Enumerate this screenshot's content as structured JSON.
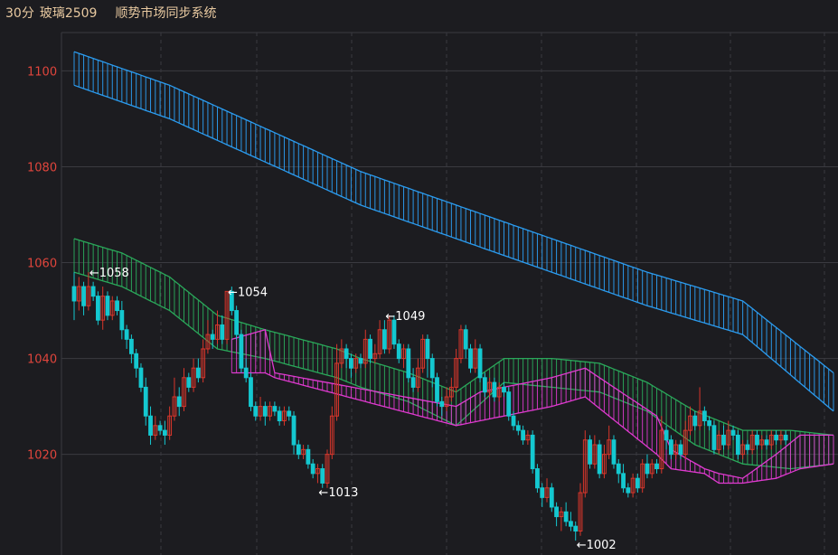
{
  "header": {
    "period": "30分",
    "symbol": "玻璃2509",
    "system": "顺势市场同步系统"
  },
  "colors": {
    "background": "#1c1c20",
    "grid": "#3a3a40",
    "tick_label": "#e0453c",
    "header_text": "#e8c9a0",
    "up_candle": "#d9362b",
    "down_candle": "#14c8d0",
    "upper_band": "#2b9cf0",
    "middle_band": "#2aa85a",
    "lower_band_line": "#e03ad0"
  },
  "chart_data": {
    "type": "candlestick",
    "ylim": [
      999,
      1108
    ],
    "yticks": [
      1020,
      1040,
      1060,
      1080,
      1100
    ],
    "xlabel": "",
    "ylabel": "",
    "grid": true,
    "bar_count": 160,
    "upper_band": {
      "top": [
        [
          0,
          1104
        ],
        [
          20,
          1097
        ],
        [
          40,
          1088
        ],
        [
          60,
          1079
        ],
        [
          80,
          1072
        ],
        [
          100,
          1065
        ],
        [
          120,
          1058
        ],
        [
          140,
          1052
        ],
        [
          159,
          1037
        ]
      ],
      "bottom": [
        [
          0,
          1097
        ],
        [
          20,
          1090
        ],
        [
          40,
          1081
        ],
        [
          60,
          1072
        ],
        [
          80,
          1065
        ],
        [
          100,
          1058
        ],
        [
          120,
          1051
        ],
        [
          140,
          1045
        ],
        [
          159,
          1029
        ]
      ]
    },
    "middle_band": {
      "top": [
        [
          0,
          1065
        ],
        [
          10,
          1062
        ],
        [
          20,
          1057
        ],
        [
          30,
          1049
        ],
        [
          40,
          1046
        ],
        [
          55,
          1042
        ],
        [
          60,
          1040
        ],
        [
          70,
          1037
        ],
        [
          80,
          1033
        ],
        [
          90,
          1040
        ],
        [
          100,
          1040
        ],
        [
          110,
          1039
        ],
        [
          120,
          1035
        ],
        [
          130,
          1029
        ],
        [
          140,
          1025
        ],
        [
          150,
          1025
        ],
        [
          159,
          1024
        ]
      ],
      "bottom": [
        [
          0,
          1058
        ],
        [
          10,
          1055
        ],
        [
          20,
          1050
        ],
        [
          30,
          1042
        ],
        [
          40,
          1040
        ],
        [
          55,
          1036
        ],
        [
          60,
          1034
        ],
        [
          70,
          1031
        ],
        [
          80,
          1026
        ],
        [
          90,
          1035
        ],
        [
          100,
          1034
        ],
        [
          110,
          1033
        ],
        [
          120,
          1029
        ],
        [
          130,
          1022
        ],
        [
          140,
          1018
        ],
        [
          150,
          1017
        ],
        [
          159,
          1018
        ]
      ]
    },
    "lower_band_line": {
      "top": [
        [
          33,
          1044
        ],
        [
          40,
          1046
        ],
        [
          42,
          1037
        ],
        [
          80,
          1030
        ],
        [
          85,
          1033
        ],
        [
          100,
          1036
        ],
        [
          107,
          1038
        ],
        [
          122,
          1028
        ],
        [
          125,
          1021
        ],
        [
          132,
          1017
        ],
        [
          135,
          1016
        ],
        [
          140,
          1015
        ],
        [
          147,
          1020
        ],
        [
          152,
          1024
        ],
        [
          159,
          1024
        ]
      ],
      "bottom": [
        [
          33,
          1037
        ],
        [
          40,
          1037
        ],
        [
          42,
          1036
        ],
        [
          80,
          1026
        ],
        [
          85,
          1027
        ],
        [
          100,
          1030
        ],
        [
          107,
          1032
        ],
        [
          122,
          1020
        ],
        [
          125,
          1017
        ],
        [
          132,
          1016
        ],
        [
          135,
          1014
        ],
        [
          140,
          1014
        ],
        [
          147,
          1015
        ],
        [
          152,
          1017
        ],
        [
          159,
          1018
        ]
      ]
    },
    "candles": [
      {
        "o": 1055,
        "c": 1052,
        "h": 1058,
        "l": 1048
      },
      {
        "o": 1052,
        "c": 1055,
        "h": 1057,
        "l": 1050
      },
      {
        "o": 1055,
        "c": 1051,
        "h": 1056,
        "l": 1049
      },
      {
        "o": 1051,
        "c": 1055,
        "h": 1058,
        "l": 1050
      },
      {
        "o": 1055,
        "c": 1053,
        "h": 1056,
        "l": 1052
      },
      {
        "o": 1053,
        "c": 1048,
        "h": 1054,
        "l": 1047
      },
      {
        "o": 1048,
        "c": 1053,
        "h": 1055,
        "l": 1046
      },
      {
        "o": 1053,
        "c": 1049,
        "h": 1054,
        "l": 1048
      },
      {
        "o": 1049,
        "c": 1052,
        "h": 1053,
        "l": 1048
      },
      {
        "o": 1052,
        "c": 1050,
        "h": 1053,
        "l": 1049
      },
      {
        "o": 1050,
        "c": 1046,
        "h": 1052,
        "l": 1044
      },
      {
        "o": 1046,
        "c": 1044,
        "h": 1047,
        "l": 1042
      },
      {
        "o": 1044,
        "c": 1041,
        "h": 1045,
        "l": 1039
      },
      {
        "o": 1041,
        "c": 1038,
        "h": 1042,
        "l": 1036
      },
      {
        "o": 1038,
        "c": 1034,
        "h": 1039,
        "l": 1033
      },
      {
        "o": 1034,
        "c": 1028,
        "h": 1036,
        "l": 1026
      },
      {
        "o": 1028,
        "c": 1024,
        "h": 1030,
        "l": 1022
      },
      {
        "o": 1024,
        "c": 1026,
        "h": 1028,
        "l": 1023
      },
      {
        "o": 1026,
        "c": 1025,
        "h": 1027,
        "l": 1024
      },
      {
        "o": 1025,
        "c": 1024,
        "h": 1027,
        "l": 1022
      },
      {
        "o": 1024,
        "c": 1028,
        "h": 1030,
        "l": 1023
      },
      {
        "o": 1028,
        "c": 1032,
        "h": 1036,
        "l": 1027
      },
      {
        "o": 1032,
        "c": 1030,
        "h": 1034,
        "l": 1028
      },
      {
        "o": 1030,
        "c": 1036,
        "h": 1038,
        "l": 1029
      },
      {
        "o": 1036,
        "c": 1034,
        "h": 1037,
        "l": 1033
      },
      {
        "o": 1034,
        "c": 1038,
        "h": 1040,
        "l": 1033
      },
      {
        "o": 1038,
        "c": 1036,
        "h": 1040,
        "l": 1035
      },
      {
        "o": 1036,
        "c": 1042,
        "h": 1044,
        "l": 1035
      },
      {
        "o": 1042,
        "c": 1045,
        "h": 1048,
        "l": 1041
      },
      {
        "o": 1045,
        "c": 1044,
        "h": 1046,
        "l": 1042
      },
      {
        "o": 1044,
        "c": 1047,
        "h": 1050,
        "l": 1043
      },
      {
        "o": 1047,
        "c": 1044,
        "h": 1049,
        "l": 1043
      },
      {
        "o": 1044,
        "c": 1054,
        "h": 1054,
        "l": 1043
      },
      {
        "o": 1054,
        "c": 1050,
        "h": 1055,
        "l": 1049
      },
      {
        "o": 1050,
        "c": 1045,
        "h": 1051,
        "l": 1044
      },
      {
        "o": 1045,
        "c": 1038,
        "h": 1046,
        "l": 1037
      },
      {
        "o": 1038,
        "c": 1036,
        "h": 1040,
        "l": 1035
      },
      {
        "o": 1036,
        "c": 1030,
        "h": 1037,
        "l": 1029
      },
      {
        "o": 1030,
        "c": 1028,
        "h": 1031,
        "l": 1027
      },
      {
        "o": 1028,
        "c": 1030,
        "h": 1032,
        "l": 1027
      },
      {
        "o": 1030,
        "c": 1028,
        "h": 1031,
        "l": 1026
      },
      {
        "o": 1028,
        "c": 1030,
        "h": 1031,
        "l": 1027
      },
      {
        "o": 1030,
        "c": 1029,
        "h": 1031,
        "l": 1028
      },
      {
        "o": 1029,
        "c": 1027,
        "h": 1030,
        "l": 1026
      },
      {
        "o": 1027,
        "c": 1029,
        "h": 1030,
        "l": 1026
      },
      {
        "o": 1029,
        "c": 1028,
        "h": 1030,
        "l": 1027
      },
      {
        "o": 1028,
        "c": 1022,
        "h": 1029,
        "l": 1020
      },
      {
        "o": 1022,
        "c": 1020,
        "h": 1023,
        "l": 1019
      },
      {
        "o": 1020,
        "c": 1021,
        "h": 1022,
        "l": 1019
      },
      {
        "o": 1021,
        "c": 1018,
        "h": 1022,
        "l": 1017
      },
      {
        "o": 1018,
        "c": 1016,
        "h": 1019,
        "l": 1015
      },
      {
        "o": 1016,
        "c": 1017,
        "h": 1018,
        "l": 1014
      },
      {
        "o": 1017,
        "c": 1014,
        "h": 1018,
        "l": 1013
      },
      {
        "o": 1014,
        "c": 1020,
        "h": 1021,
        "l": 1013
      },
      {
        "o": 1020,
        "c": 1028,
        "h": 1030,
        "l": 1019
      },
      {
        "o": 1028,
        "c": 1039,
        "h": 1043,
        "l": 1027
      },
      {
        "o": 1039,
        "c": 1042,
        "h": 1044,
        "l": 1038
      },
      {
        "o": 1042,
        "c": 1040,
        "h": 1043,
        "l": 1038
      },
      {
        "o": 1040,
        "c": 1038,
        "h": 1041,
        "l": 1036
      },
      {
        "o": 1038,
        "c": 1040,
        "h": 1041,
        "l": 1037
      },
      {
        "o": 1040,
        "c": 1039,
        "h": 1041,
        "l": 1038
      },
      {
        "o": 1039,
        "c": 1044,
        "h": 1046,
        "l": 1038
      },
      {
        "o": 1044,
        "c": 1040,
        "h": 1045,
        "l": 1039
      },
      {
        "o": 1040,
        "c": 1041,
        "h": 1043,
        "l": 1039
      },
      {
        "o": 1041,
        "c": 1046,
        "h": 1048,
        "l": 1040
      },
      {
        "o": 1046,
        "c": 1042,
        "h": 1048,
        "l": 1041
      },
      {
        "o": 1042,
        "c": 1048,
        "h": 1049,
        "l": 1041
      },
      {
        "o": 1048,
        "c": 1043,
        "h": 1049,
        "l": 1042
      },
      {
        "o": 1043,
        "c": 1040,
        "h": 1044,
        "l": 1039
      },
      {
        "o": 1040,
        "c": 1042,
        "h": 1043,
        "l": 1038
      },
      {
        "o": 1042,
        "c": 1036,
        "h": 1043,
        "l": 1035
      },
      {
        "o": 1036,
        "c": 1034,
        "h": 1038,
        "l": 1033
      },
      {
        "o": 1034,
        "c": 1038,
        "h": 1040,
        "l": 1033
      },
      {
        "o": 1038,
        "c": 1044,
        "h": 1045,
        "l": 1037
      },
      {
        "o": 1044,
        "c": 1040,
        "h": 1045,
        "l": 1036
      },
      {
        "o": 1040,
        "c": 1036,
        "h": 1041,
        "l": 1034
      },
      {
        "o": 1036,
        "c": 1031,
        "h": 1037,
        "l": 1030
      },
      {
        "o": 1031,
        "c": 1030,
        "h": 1032,
        "l": 1028
      },
      {
        "o": 1030,
        "c": 1032,
        "h": 1034,
        "l": 1029
      },
      {
        "o": 1032,
        "c": 1034,
        "h": 1036,
        "l": 1031
      },
      {
        "o": 1034,
        "c": 1040,
        "h": 1042,
        "l": 1033
      },
      {
        "o": 1040,
        "c": 1046,
        "h": 1047,
        "l": 1039
      },
      {
        "o": 1046,
        "c": 1042,
        "h": 1047,
        "l": 1040
      },
      {
        "o": 1042,
        "c": 1038,
        "h": 1043,
        "l": 1037
      },
      {
        "o": 1038,
        "c": 1042,
        "h": 1044,
        "l": 1037
      },
      {
        "o": 1042,
        "c": 1036,
        "h": 1043,
        "l": 1035
      },
      {
        "o": 1036,
        "c": 1033,
        "h": 1037,
        "l": 1032
      },
      {
        "o": 1033,
        "c": 1035,
        "h": 1036,
        "l": 1032
      },
      {
        "o": 1035,
        "c": 1032,
        "h": 1036,
        "l": 1031
      },
      {
        "o": 1032,
        "c": 1034,
        "h": 1035,
        "l": 1031
      },
      {
        "o": 1034,
        "c": 1033,
        "h": 1035,
        "l": 1032
      },
      {
        "o": 1033,
        "c": 1028,
        "h": 1034,
        "l": 1027
      },
      {
        "o": 1028,
        "c": 1026,
        "h": 1029,
        "l": 1025
      },
      {
        "o": 1026,
        "c": 1025,
        "h": 1027,
        "l": 1024
      },
      {
        "o": 1025,
        "c": 1023,
        "h": 1026,
        "l": 1022
      },
      {
        "o": 1023,
        "c": 1024,
        "h": 1025,
        "l": 1022
      },
      {
        "o": 1024,
        "c": 1017,
        "h": 1025,
        "l": 1016
      },
      {
        "o": 1017,
        "c": 1013,
        "h": 1018,
        "l": 1012
      },
      {
        "o": 1013,
        "c": 1011,
        "h": 1014,
        "l": 1009
      },
      {
        "o": 1011,
        "c": 1013,
        "h": 1015,
        "l": 1010
      },
      {
        "o": 1013,
        "c": 1009,
        "h": 1014,
        "l": 1008
      },
      {
        "o": 1009,
        "c": 1007,
        "h": 1010,
        "l": 1005
      },
      {
        "o": 1007,
        "c": 1008,
        "h": 1009,
        "l": 1004
      },
      {
        "o": 1008,
        "c": 1006,
        "h": 1010,
        "l": 1005
      },
      {
        "o": 1006,
        "c": 1005,
        "h": 1008,
        "l": 1004
      },
      {
        "o": 1005,
        "c": 1004,
        "h": 1006,
        "l": 1002
      },
      {
        "o": 1004,
        "c": 1012,
        "h": 1014,
        "l": 1003
      },
      {
        "o": 1012,
        "c": 1023,
        "h": 1025,
        "l": 1011
      },
      {
        "o": 1023,
        "c": 1018,
        "h": 1024,
        "l": 1017
      },
      {
        "o": 1018,
        "c": 1022,
        "h": 1024,
        "l": 1017
      },
      {
        "o": 1022,
        "c": 1016,
        "h": 1023,
        "l": 1015
      },
      {
        "o": 1016,
        "c": 1020,
        "h": 1022,
        "l": 1015
      },
      {
        "o": 1020,
        "c": 1023,
        "h": 1026,
        "l": 1019
      },
      {
        "o": 1023,
        "c": 1018,
        "h": 1024,
        "l": 1017
      },
      {
        "o": 1018,
        "c": 1016,
        "h": 1019,
        "l": 1014
      },
      {
        "o": 1016,
        "c": 1013,
        "h": 1018,
        "l": 1012
      },
      {
        "o": 1013,
        "c": 1012,
        "h": 1014,
        "l": 1011
      },
      {
        "o": 1012,
        "c": 1015,
        "h": 1016,
        "l": 1011
      },
      {
        "o": 1015,
        "c": 1013,
        "h": 1016,
        "l": 1012
      },
      {
        "o": 1013,
        "c": 1018,
        "h": 1019,
        "l": 1012
      },
      {
        "o": 1018,
        "c": 1016,
        "h": 1020,
        "l": 1015
      },
      {
        "o": 1016,
        "c": 1018,
        "h": 1019,
        "l": 1015
      },
      {
        "o": 1018,
        "c": 1017,
        "h": 1019,
        "l": 1016
      },
      {
        "o": 1017,
        "c": 1025,
        "h": 1028,
        "l": 1016
      },
      {
        "o": 1025,
        "c": 1023,
        "h": 1026,
        "l": 1021
      },
      {
        "o": 1023,
        "c": 1020,
        "h": 1024,
        "l": 1019
      },
      {
        "o": 1020,
        "c": 1022,
        "h": 1023,
        "l": 1019
      },
      {
        "o": 1022,
        "c": 1020,
        "h": 1023,
        "l": 1019
      },
      {
        "o": 1020,
        "c": 1025,
        "h": 1027,
        "l": 1019
      },
      {
        "o": 1025,
        "c": 1028,
        "h": 1030,
        "l": 1024
      },
      {
        "o": 1028,
        "c": 1026,
        "h": 1029,
        "l": 1025
      },
      {
        "o": 1026,
        "c": 1029,
        "h": 1034,
        "l": 1025
      },
      {
        "o": 1029,
        "c": 1027,
        "h": 1030,
        "l": 1026
      },
      {
        "o": 1027,
        "c": 1026,
        "h": 1028,
        "l": 1025
      },
      {
        "o": 1026,
        "c": 1021,
        "h": 1027,
        "l": 1020
      },
      {
        "o": 1021,
        "c": 1024,
        "h": 1025,
        "l": 1020
      },
      {
        "o": 1024,
        "c": 1022,
        "h": 1026,
        "l": 1021
      },
      {
        "o": 1022,
        "c": 1025,
        "h": 1027,
        "l": 1021
      },
      {
        "o": 1025,
        "c": 1024,
        "h": 1026,
        "l": 1023
      },
      {
        "o": 1024,
        "c": 1020,
        "h": 1025,
        "l": 1019
      },
      {
        "o": 1020,
        "c": 1022,
        "h": 1023,
        "l": 1019
      },
      {
        "o": 1022,
        "c": 1021,
        "h": 1023,
        "l": 1020
      },
      {
        "o": 1021,
        "c": 1024,
        "h": 1025,
        "l": 1020
      },
      {
        "o": 1024,
        "c": 1022,
        "h": 1025,
        "l": 1021
      },
      {
        "o": 1022,
        "c": 1023,
        "h": 1024,
        "l": 1021
      },
      {
        "o": 1023,
        "c": 1022,
        "h": 1024,
        "l": 1021
      },
      {
        "o": 1022,
        "c": 1024,
        "h": 1025,
        "l": 1021
      },
      {
        "o": 1024,
        "c": 1023,
        "h": 1025,
        "l": 1022
      },
      {
        "o": 1023,
        "c": 1024,
        "h": 1025,
        "l": 1022
      },
      {
        "o": 1024,
        "c": 1023,
        "h": 1025,
        "l": 1022
      }
    ],
    "annotations": [
      {
        "bar": 3,
        "value": 1058,
        "label": "←1058"
      },
      {
        "bar": 32,
        "value": 1054,
        "label": "←1054"
      },
      {
        "bar": 65,
        "value": 1049,
        "label": "←1049"
      },
      {
        "bar": 51,
        "value": 1013,
        "label": "←1013"
      },
      {
        "bar": 105,
        "value": 1002,
        "label": "←1002"
      }
    ]
  }
}
